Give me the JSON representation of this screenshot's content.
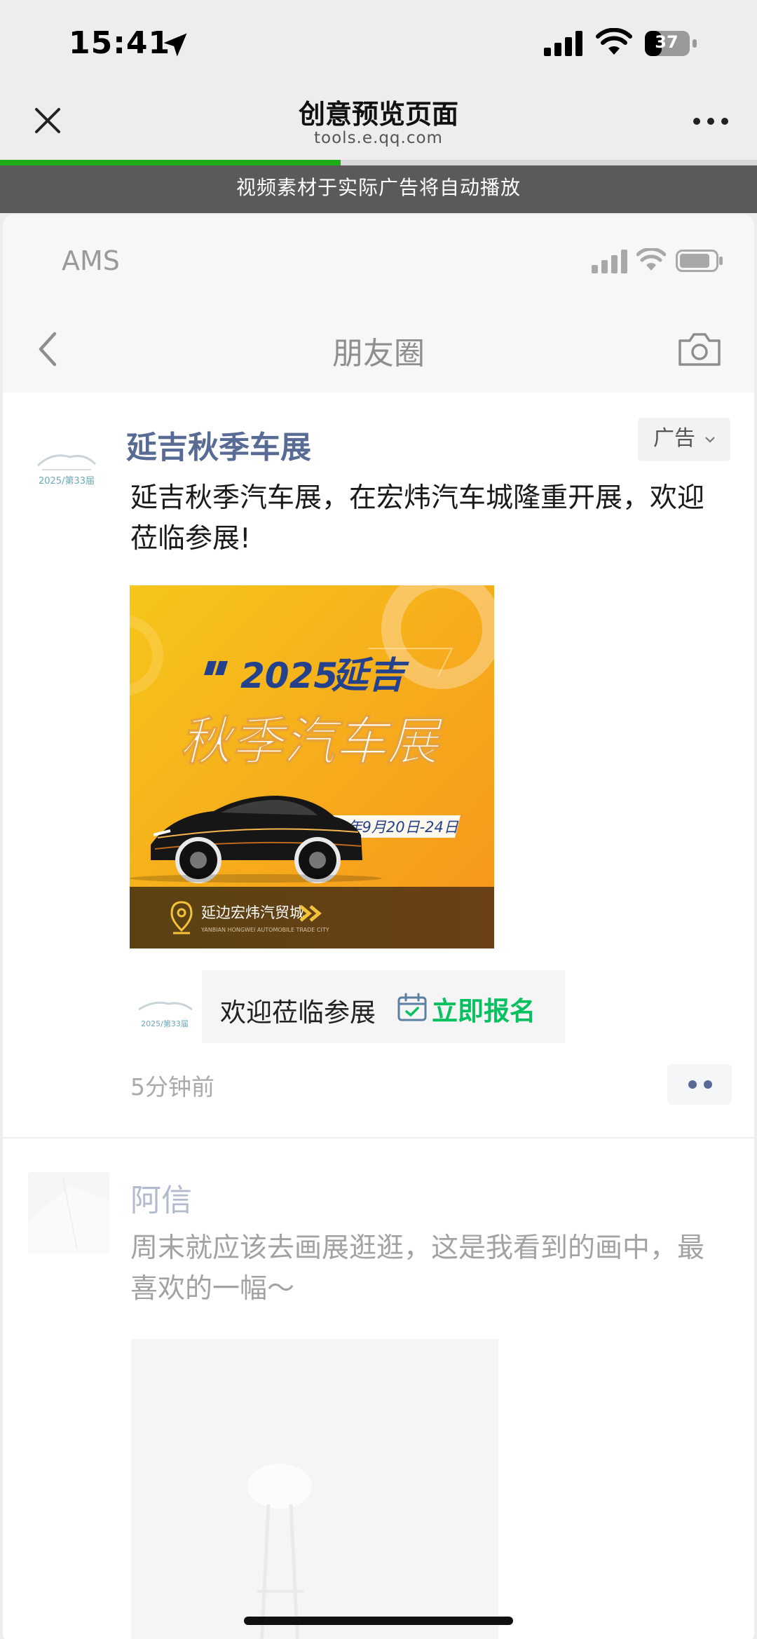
{
  "status_bar": {
    "time": "15:41",
    "battery": "37"
  },
  "header": {
    "title": "创意预览页面",
    "domain": "tools.e.qq.com",
    "progress": 0.45
  },
  "notice": "视频素材于实际广告将自动播放",
  "preview": {
    "carrier": "AMS",
    "page_title": "朋友圈"
  },
  "ad_post": {
    "name": "延吉秋季车展",
    "ad_tag": "广告",
    "text": "延吉秋季汽车展，在宏炜汽车城隆重开展，欢迎莅临参展!",
    "logo_text": "2025/第33届",
    "image": {
      "year": "2025",
      "city": "延吉",
      "headline": "秋季汽车展",
      "date": "2025年9月20日-24日",
      "venue": "延边宏炜汽贸城",
      "venue_en": "YANBIAN HONGWEI AUTOMOBILE TRADE CITY"
    },
    "cta_text": "欢迎莅临参展",
    "cta_button": "立即报名",
    "time": "5分钟前"
  },
  "next_post": {
    "name": "阿信",
    "text": "周末就应该去画展逛逛，这是我看到的画中，最喜欢的一幅～"
  },
  "colors": {
    "accent_green": "#07c160",
    "progress_green": "#1aad19",
    "link_blue": "#576b95"
  }
}
